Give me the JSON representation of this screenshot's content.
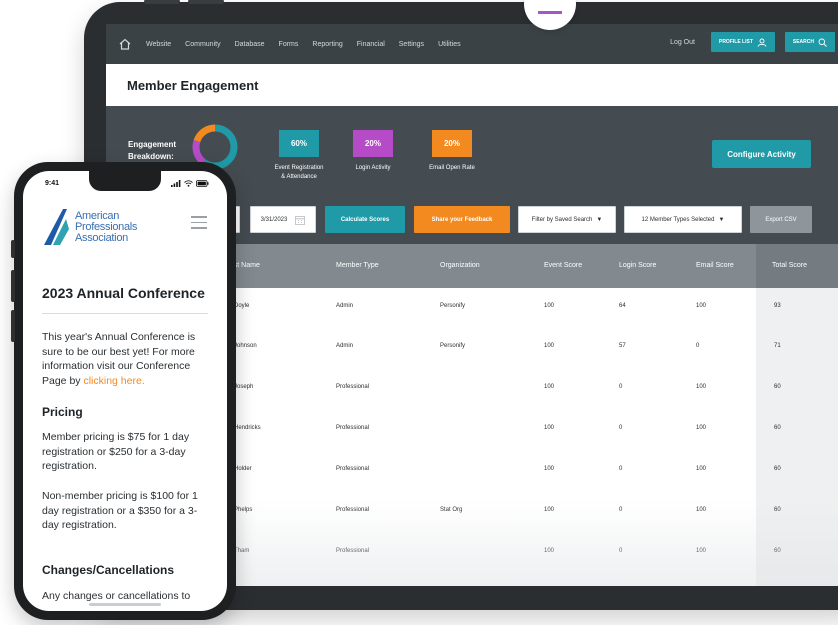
{
  "tablet": {
    "nav": {
      "items": [
        "Website",
        "Community",
        "Database",
        "Forms",
        "Reporting",
        "Financial",
        "Settings",
        "Utilities"
      ],
      "logout": "Log Out",
      "profile_list": "PROFILE LIST",
      "search": "SEARCH"
    },
    "page_title": "Member Engagement",
    "engagement": {
      "label": "Engagement Breakdown:",
      "stats": [
        {
          "value": "60%",
          "label_line1": "Event Registration",
          "label_line2": "& Attendance",
          "color": "#1f9aa6"
        },
        {
          "value": "20%",
          "label_line1": "Login Activity",
          "label_line2": "",
          "color": "#b64bc7"
        },
        {
          "value": "20%",
          "label_line1": "Email Open Rate",
          "label_line2": "",
          "color": "#f38a1f"
        }
      ],
      "configure": "Configure Activity"
    },
    "controls": {
      "date": "3/31/2023",
      "calculate": "Calculate Scores",
      "feedback": "Share your Feedback",
      "filter": "Filter by Saved Search",
      "member_types": "12 Member Types Selected",
      "export": "Export CSV"
    },
    "table": {
      "headers": [
        "Last Name",
        "Member Type",
        "Organization",
        "Event Score",
        "Login Score",
        "Email Score",
        "Total Score"
      ],
      "rows": [
        [
          "Doyle",
          "Admin",
          "Personify",
          "100",
          "64",
          "100",
          "93"
        ],
        [
          "Johnson",
          "Admin",
          "Personify",
          "100",
          "57",
          "0",
          "71"
        ],
        [
          "Joseph",
          "Professional",
          "",
          "100",
          "0",
          "100",
          "60"
        ],
        [
          "Hendricks",
          "Professional",
          "",
          "100",
          "0",
          "100",
          "60"
        ],
        [
          "Holder",
          "Professional",
          "",
          "100",
          "0",
          "100",
          "60"
        ],
        [
          "Phelps",
          "Professional",
          "Stat Org",
          "100",
          "0",
          "100",
          "60"
        ],
        [
          "Tham",
          "Professional",
          "",
          "100",
          "0",
          "100",
          "60"
        ]
      ]
    }
  },
  "phone": {
    "time": "9:41",
    "logo": {
      "line1": "American",
      "line2": "Professionals",
      "line3": "Association"
    },
    "title": "2023 Annual Conference",
    "intro": "This year's Annual Conference is sure to be our best yet! For more information visit our Conference Page by ",
    "intro_link": "clicking here.",
    "pricing_heading": "Pricing",
    "pricing_member": "Member pricing is $75 for 1 day registration or $250 for a 3-day registration.",
    "pricing_nonmember": "Non-member pricing is $100 for 1 day registration or a $350 for a 3-day registration.",
    "changes_heading": "Changes/Cancellations",
    "changes_text": "Any changes or cancellations to"
  }
}
